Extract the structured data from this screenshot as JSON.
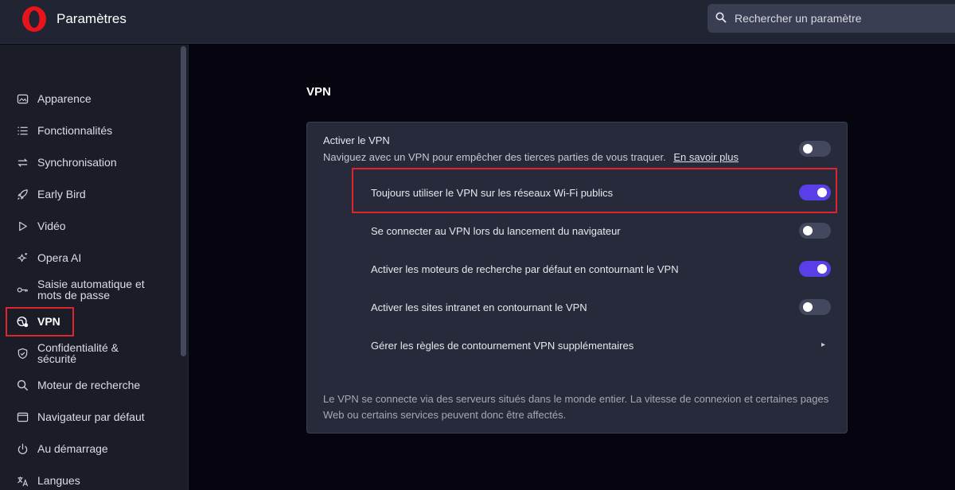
{
  "header": {
    "title": "Paramètres",
    "search_placeholder": "Rechercher un paramètre"
  },
  "sidebar": {
    "items": [
      {
        "label": "Apparence",
        "icon": "image-icon"
      },
      {
        "label": "Fonctionnalités",
        "icon": "list-icon"
      },
      {
        "label": "Synchronisation",
        "icon": "sync-icon"
      },
      {
        "label": "Early Bird",
        "icon": "rocket-icon"
      },
      {
        "label": "Vidéo",
        "icon": "play-icon"
      },
      {
        "label": "Opera AI",
        "icon": "sparkle-icon"
      },
      {
        "label_line1": "Saisie automatique et",
        "label_line2": "mots de passe",
        "icon": "key-icon"
      },
      {
        "label": "VPN",
        "icon": "vpn-globe-icon",
        "active": true
      },
      {
        "label_line1": "Confidentialité &",
        "label_line2": "sécurité",
        "icon": "shield-icon"
      },
      {
        "label": "Moteur de recherche",
        "icon": "search-icon"
      },
      {
        "label": "Navigateur par défaut",
        "icon": "browser-window-icon"
      },
      {
        "label": "Au démarrage",
        "icon": "power-icon"
      },
      {
        "label": "Langues",
        "icon": "language-icon"
      }
    ]
  },
  "main": {
    "section_title": "VPN",
    "enable_vpn": {
      "title": "Activer le VPN",
      "description": "Naviguez avec un VPN pour empêcher des tierces parties de vous traquer.",
      "learn_more": "En savoir plus",
      "enabled": false
    },
    "options": [
      {
        "label": "Toujours utiliser le VPN sur les réseaux Wi-Fi publics",
        "enabled": true
      },
      {
        "label": "Se connecter au VPN lors du lancement du navigateur",
        "enabled": false
      },
      {
        "label": "Activer les moteurs de recherche par défaut en contournant le VPN",
        "enabled": true
      },
      {
        "label": "Activer les sites intranet en contournant le VPN",
        "enabled": false
      }
    ],
    "bypass_rules_label": "Gérer les règles de contournement VPN supplémentaires",
    "footer_note": "Le VPN se connecte via des serveurs situés dans le monde entier. La vitesse de connexion et certaines pages Web ou certains services peuvent donc être affectés."
  },
  "colors": {
    "accent": "#5a3ee8",
    "highlight": "#e0242c",
    "logo": "#e8141b"
  }
}
